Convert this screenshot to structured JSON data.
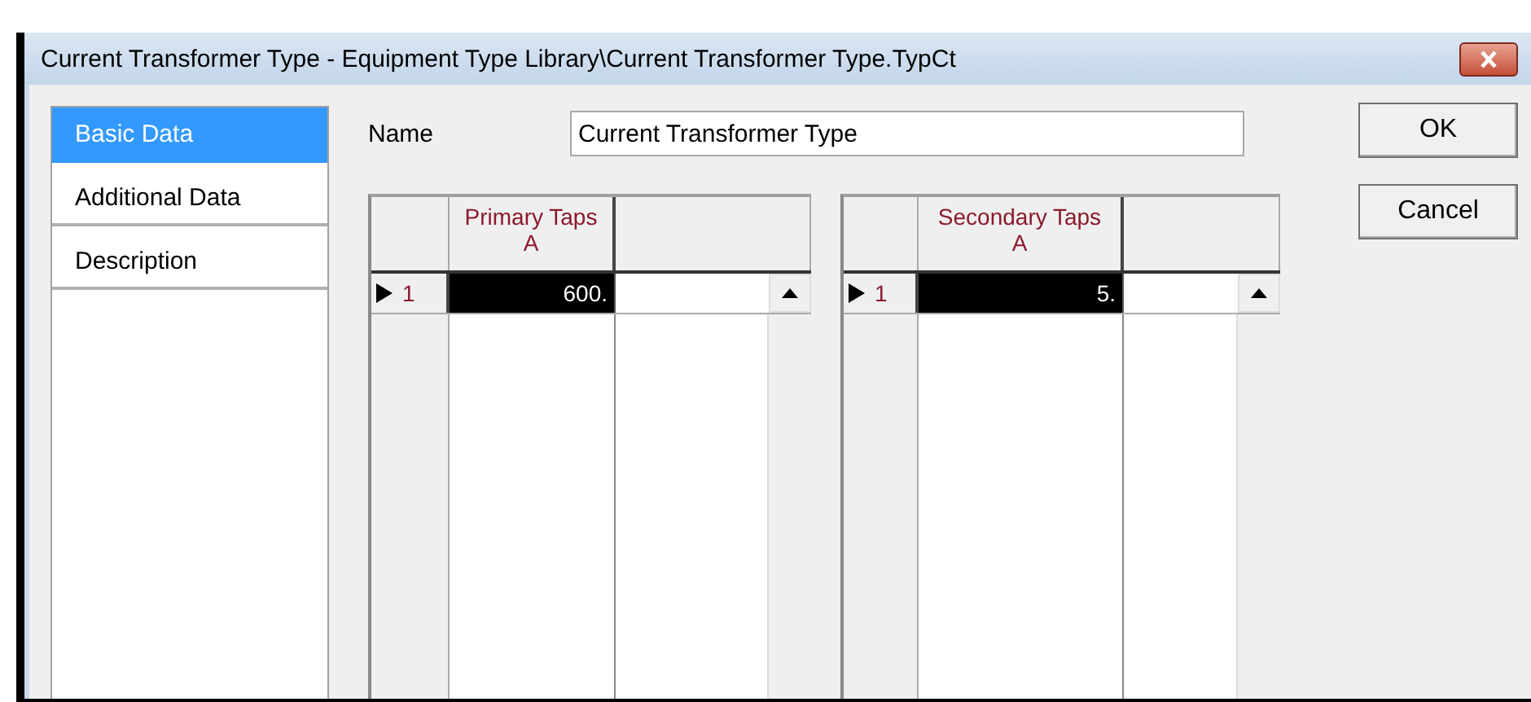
{
  "window": {
    "title": "Current Transformer Type - Equipment Type Library\\Current Transformer Type.TypCt"
  },
  "tabs": [
    {
      "label": "Basic Data",
      "selected": true
    },
    {
      "label": "Additional Data",
      "selected": false
    },
    {
      "label": "Description",
      "selected": false
    }
  ],
  "name_field": {
    "label": "Name",
    "value": "Current Transformer Type"
  },
  "grids": [
    {
      "column": [
        "Primary Taps",
        "A"
      ],
      "rows": [
        {
          "number": "1",
          "value": "600.",
          "selected": true
        }
      ]
    },
    {
      "column": [
        "Secondary Taps",
        "A"
      ],
      "rows": [
        {
          "number": "1",
          "value": "5.",
          "selected": true
        }
      ]
    }
  ],
  "buttons": [
    "OK",
    "Cancel"
  ]
}
